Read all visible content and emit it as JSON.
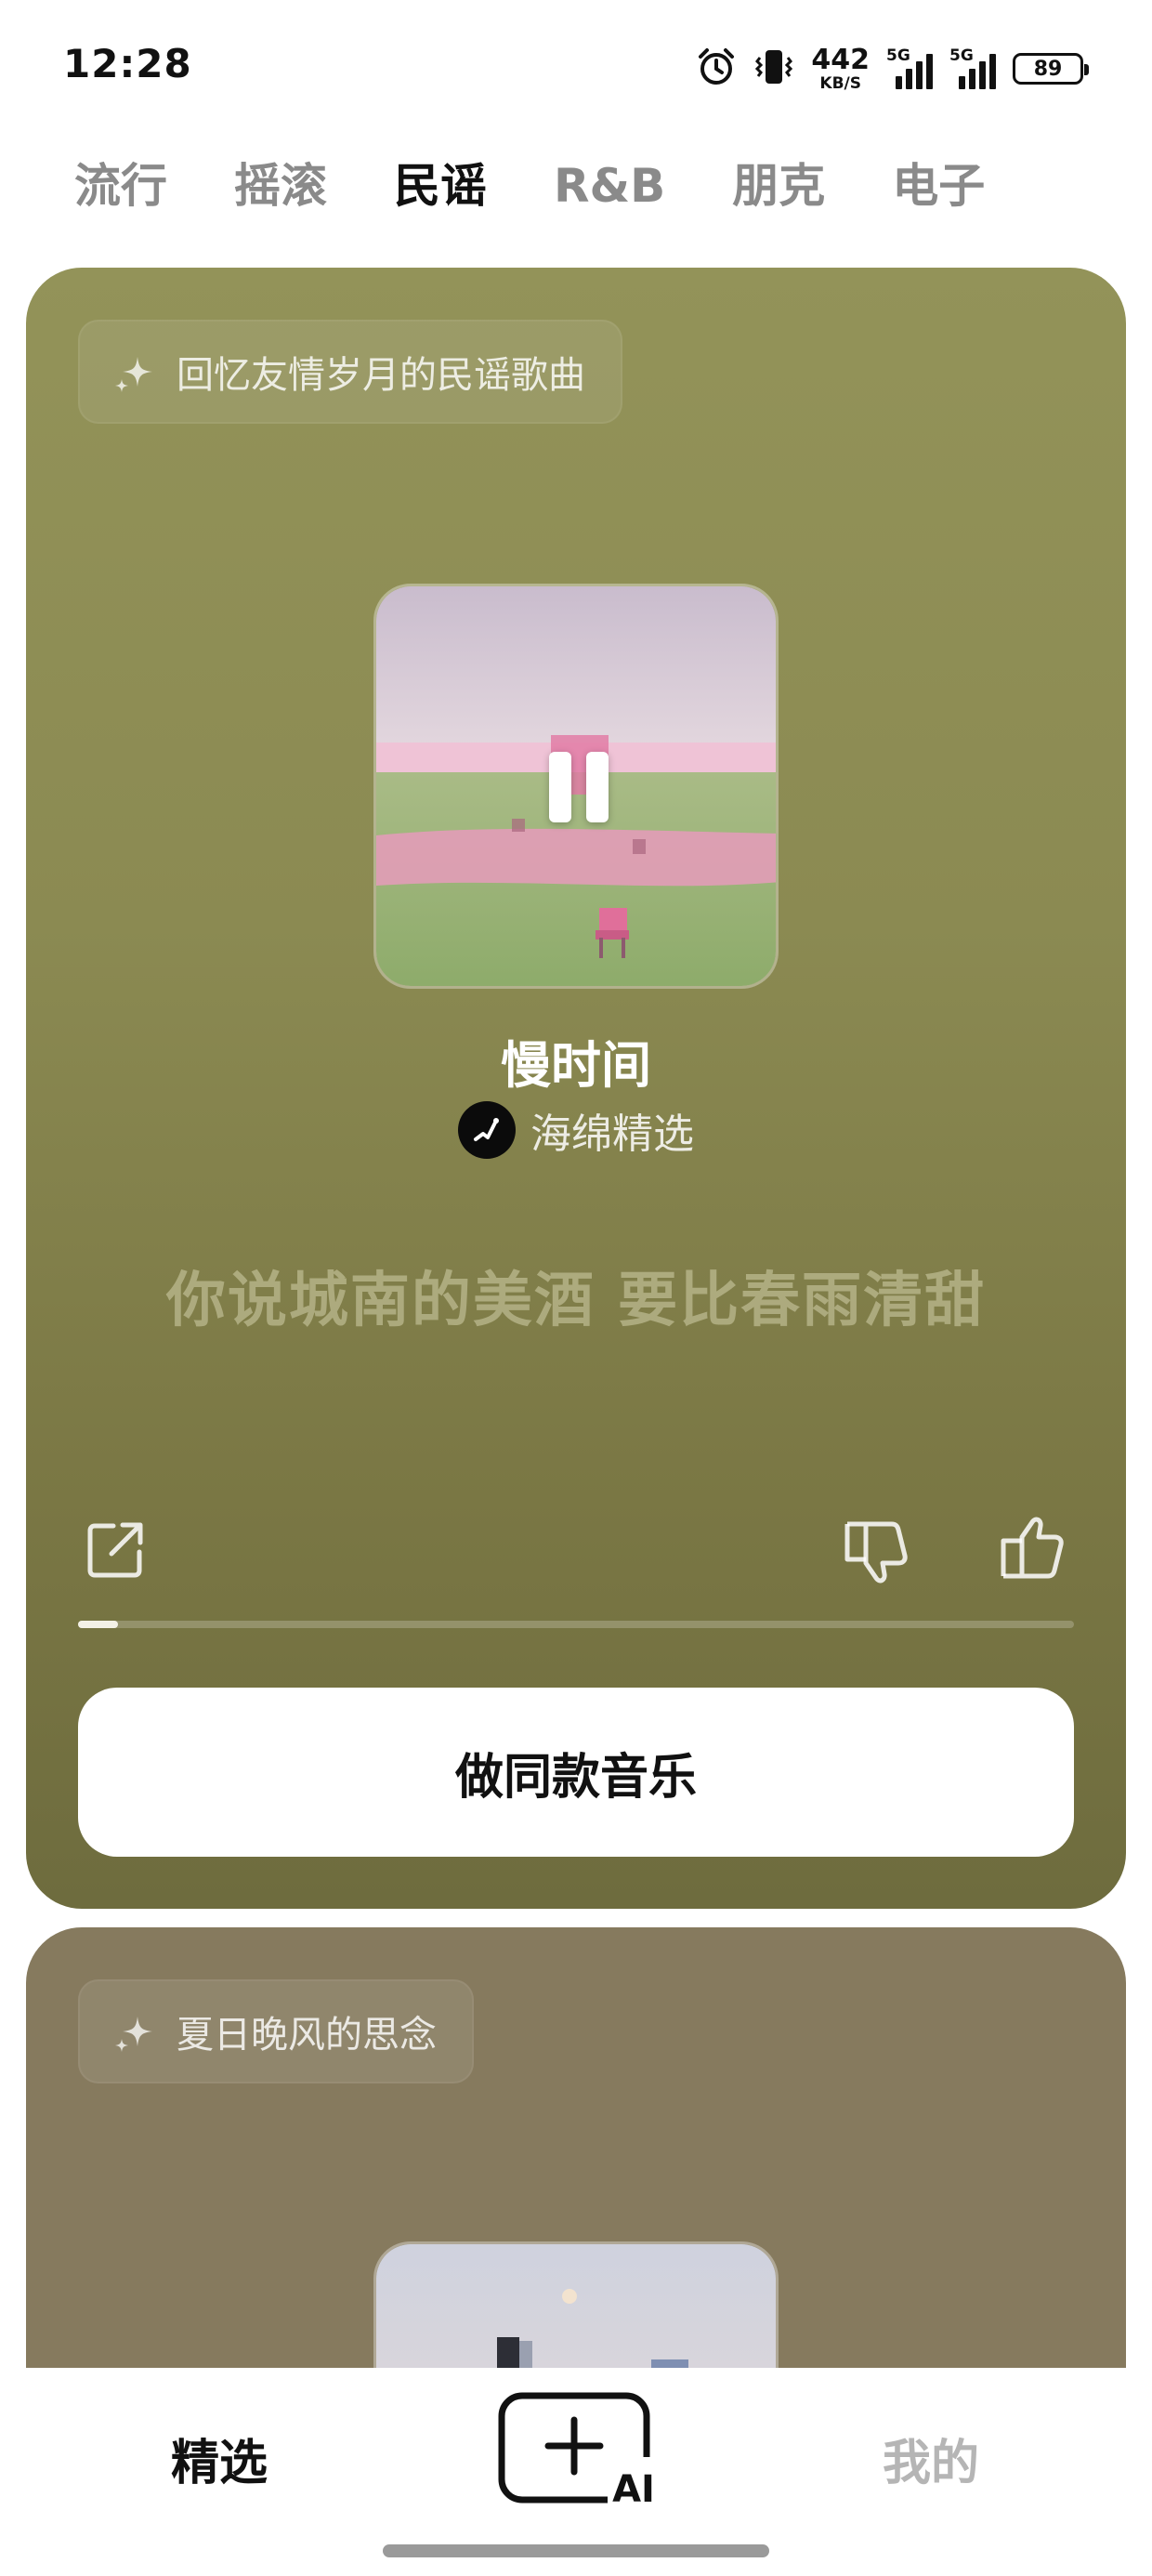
{
  "status_bar": {
    "time": "12:28",
    "net_speed": "442",
    "net_speed_unit": "KB/S",
    "signal1_label": "5G",
    "signal2_label": "5G",
    "battery": "89"
  },
  "genre_tabs": [
    {
      "label": "流行",
      "active": false
    },
    {
      "label": "摇滚",
      "active": false
    },
    {
      "label": "民谣",
      "active": true
    },
    {
      "label": "R&B",
      "active": false
    },
    {
      "label": "朋克",
      "active": false
    },
    {
      "label": "电子",
      "active": false
    }
  ],
  "cards": [
    {
      "prompt": "回忆友情岁月的民谣歌曲",
      "song_title": "慢时间",
      "artist": "海绵精选",
      "lyric": "你说城南的美酒 要比春雨清甜",
      "progress": 0.04,
      "action_button": "做同款音乐",
      "background": "#8b8a52"
    },
    {
      "prompt": "夏日晚风的思念",
      "background": "#867a5e"
    }
  ],
  "bottom_nav": {
    "featured": "精选",
    "create_ai_badge": "AI",
    "mine": "我的"
  },
  "icons": [
    "alarm-icon",
    "vibrate-icon",
    "sparkle-icon",
    "pause-icon",
    "share-icon",
    "thumbs-down-icon",
    "thumbs-up-icon",
    "create-plus-icon"
  ]
}
